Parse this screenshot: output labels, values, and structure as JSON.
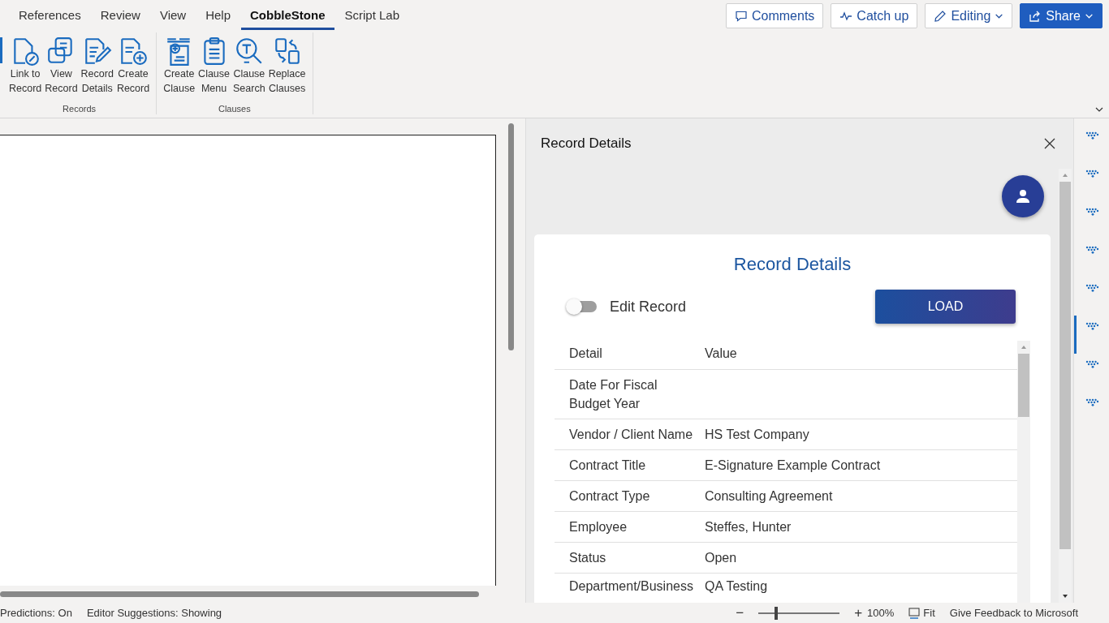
{
  "tabs": [
    {
      "label": "References",
      "selected": false
    },
    {
      "label": "Review",
      "selected": false
    },
    {
      "label": "View",
      "selected": false
    },
    {
      "label": "Help",
      "selected": false
    },
    {
      "label": "CobbleStone",
      "selected": true
    },
    {
      "label": "Script Lab",
      "selected": false
    }
  ],
  "top_buttons": [
    {
      "kind": "comments",
      "label": "Comments",
      "primary": false,
      "dropdown": false
    },
    {
      "kind": "catchup",
      "label": "Catch up",
      "primary": false,
      "dropdown": false
    },
    {
      "kind": "editing",
      "label": "Editing",
      "primary": false,
      "dropdown": true
    },
    {
      "kind": "share",
      "label": "Share",
      "primary": true,
      "dropdown": true
    }
  ],
  "ribbon_groups": [
    {
      "label": "Records",
      "buttons": [
        {
          "kind": "link",
          "label": "Link to\nRecord"
        },
        {
          "kind": "view",
          "label": "View\nRecord"
        },
        {
          "kind": "details",
          "label": "Record\nDetails"
        },
        {
          "kind": "create",
          "label": "Create\nRecord"
        }
      ]
    },
    {
      "label": "Clauses",
      "buttons": [
        {
          "kind": "create_clause",
          "label": "Create\nClause"
        },
        {
          "kind": "menu",
          "label": "Clause\nMenu"
        },
        {
          "kind": "search",
          "label": "Clause\nSearch"
        },
        {
          "kind": "replace",
          "label": "Replace\nClauses"
        }
      ]
    }
  ],
  "pane": {
    "title": "Record Details",
    "card_title": "Record Details",
    "edit_toggle": {
      "label": "Edit Record",
      "on": false
    },
    "load_button": "LOAD",
    "table": {
      "columns": [
        "Detail",
        "Value"
      ],
      "rows": [
        {
          "detail": "Date For Fiscal Budget Year",
          "value": ""
        },
        {
          "detail": "Vendor / Client Name",
          "value": "HS Test Company"
        },
        {
          "detail": "Contract Title",
          "value": "E-Signature Example Contract"
        },
        {
          "detail": "Contract Type",
          "value": "Consulting Agreement"
        },
        {
          "detail": "Employee",
          "value": "Steffes, Hunter"
        },
        {
          "detail": "Status",
          "value": "Open"
        },
        {
          "detail": "Department/Business",
          "value": "QA Testing"
        }
      ]
    }
  },
  "rail_items": [
    {
      "selected": false
    },
    {
      "selected": false
    },
    {
      "selected": false
    },
    {
      "selected": false
    },
    {
      "selected": false
    },
    {
      "selected": true
    },
    {
      "selected": false
    },
    {
      "selected": false
    }
  ],
  "status_bar": {
    "left": [
      "Predictions: On",
      "Editor Suggestions: Showing"
    ],
    "zoom_out": "−",
    "zoom": {
      "level": 0.24
    },
    "zoom_in": "+",
    "zoom_value": "100%",
    "fit": "Fit",
    "feedback": "Give Feedback to Microsoft"
  }
}
